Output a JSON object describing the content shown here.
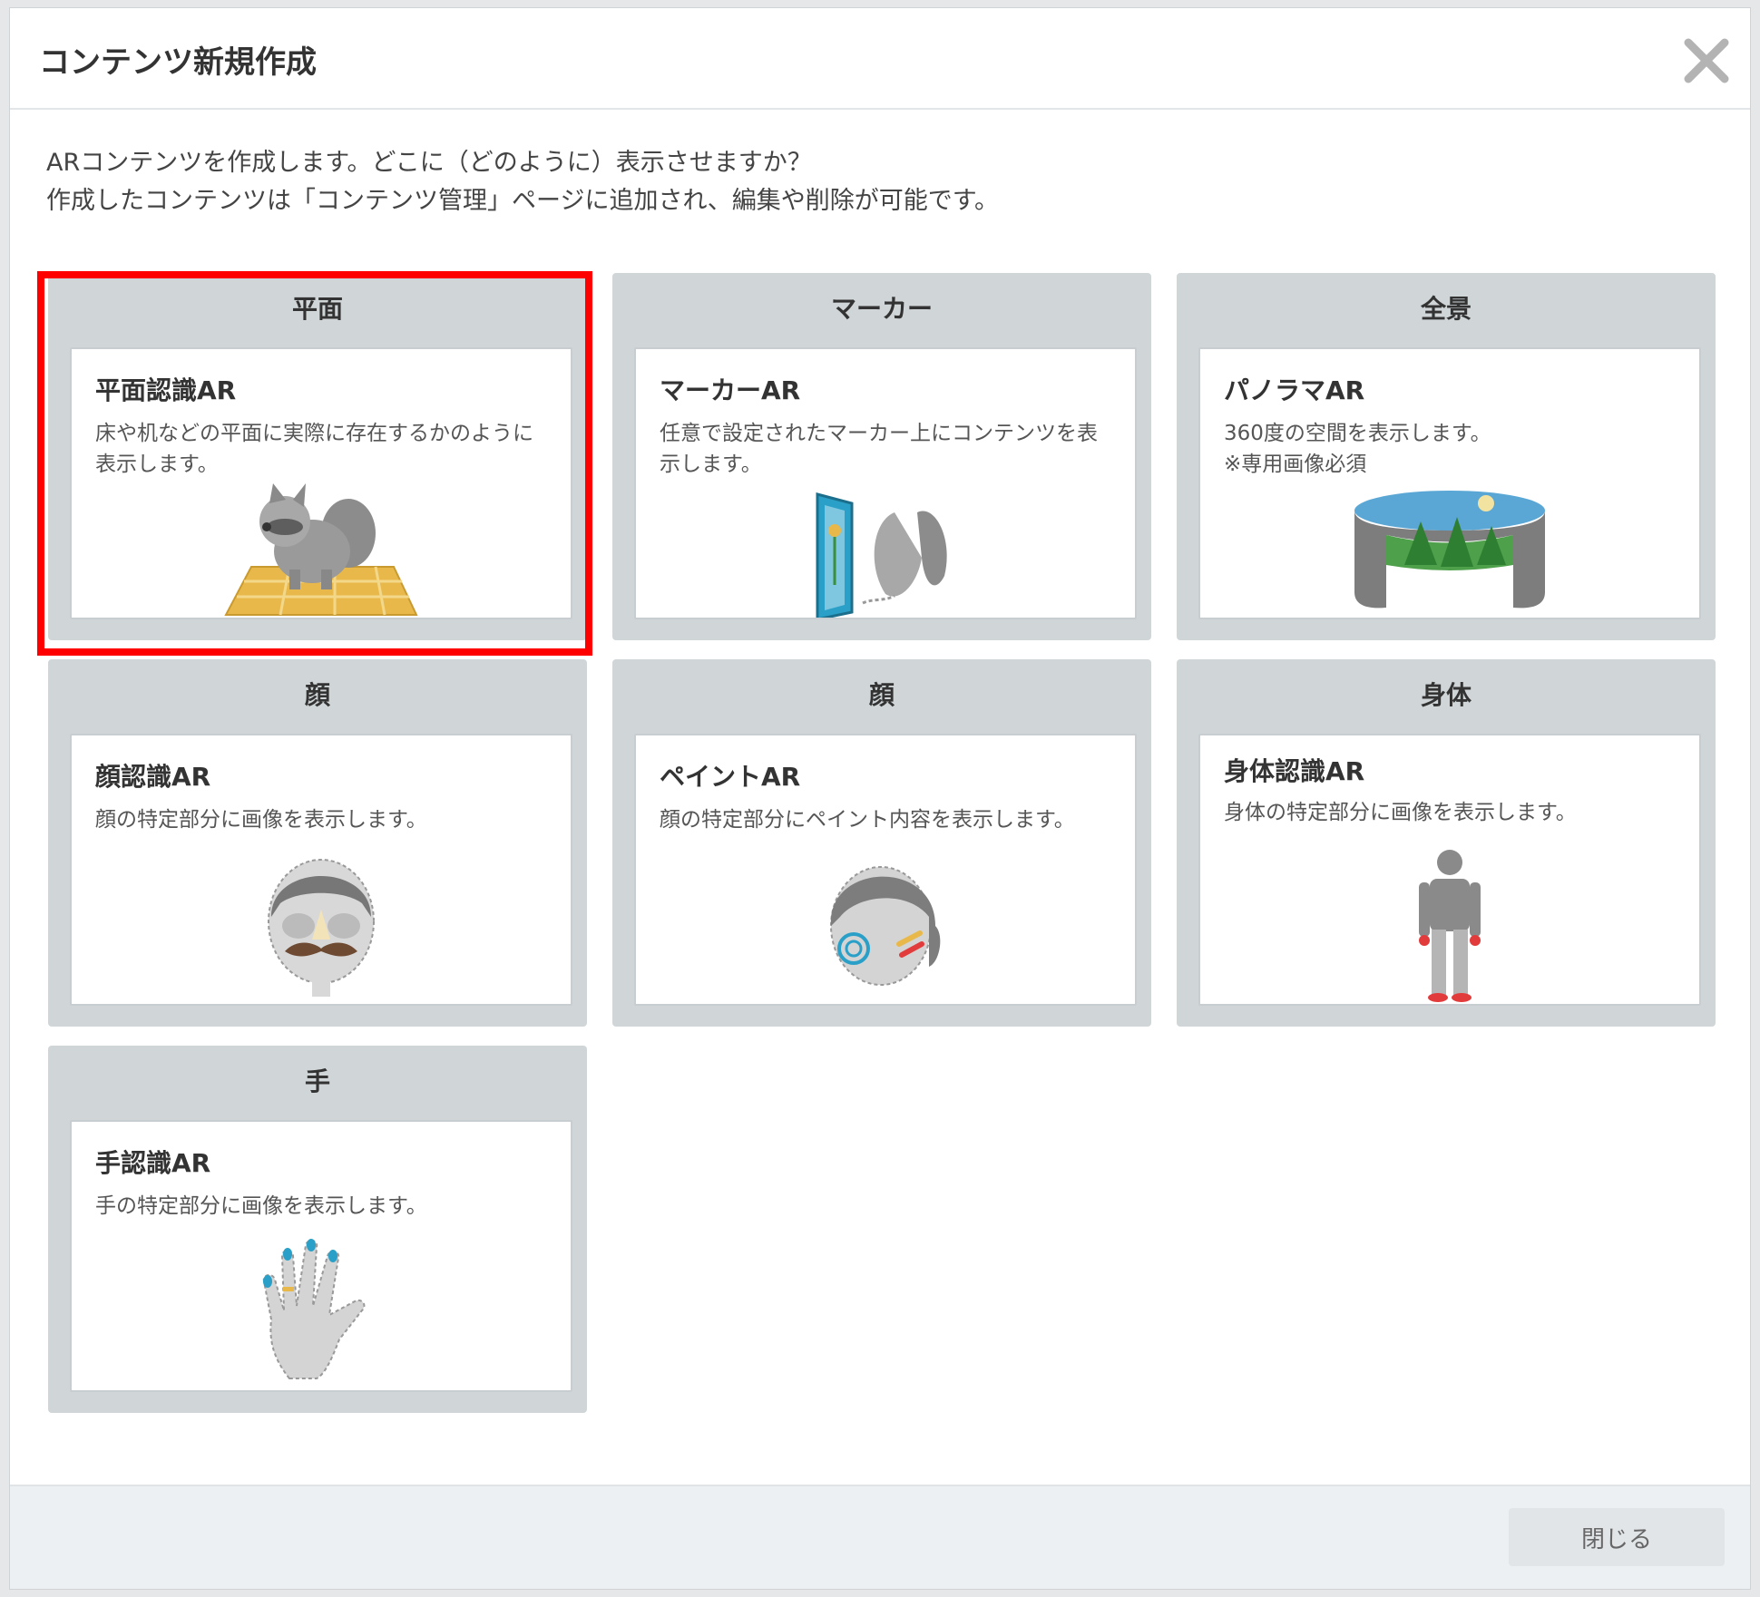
{
  "dialog": {
    "title": "コンテンツ新規作成",
    "close_icon": "close-x-icon"
  },
  "intro": {
    "line1": "ARコンテンツを作成します。どこに（どのように）表示させますか？",
    "line2": "作成したコンテンツは「コンテンツ管理」ページに追加され、編集や削除が可能です。"
  },
  "cards": [
    {
      "category": "平面",
      "name": "平面認識AR",
      "desc": "床や机などの平面に実際に存在するかのように表示します。",
      "icon": "raccoon-on-floor-icon",
      "selected": true
    },
    {
      "category": "マーカー",
      "name": "マーカーAR",
      "desc": "任意で設定されたマーカー上にコンテンツを表示します。",
      "icon": "marker-butterfly-icon",
      "selected": false
    },
    {
      "category": "全景",
      "name": "パノラマAR",
      "desc": "360度の空間を表示します。\n※専用画像必須",
      "icon": "panorama-cylinder-icon",
      "selected": false
    },
    {
      "category": "顔",
      "name": "顔認識AR",
      "desc": "顔の特定部分に画像を表示します。",
      "icon": "face-mustache-icon",
      "selected": false
    },
    {
      "category": "顔",
      "name": "ペイントAR",
      "desc": "顔の特定部分にペイント内容を表示します。",
      "icon": "face-paint-icon",
      "selected": false
    },
    {
      "category": "身体",
      "name": "身体認識AR",
      "desc": "身体の特定部分に画像を表示します。",
      "icon": "body-figure-icon",
      "selected": false
    },
    {
      "category": "手",
      "name": "手認識AR",
      "desc": "手の特定部分に画像を表示します。",
      "icon": "hand-icon",
      "selected": false
    }
  ],
  "footer": {
    "close_label": "閉じる"
  },
  "colors": {
    "card_bg": "#d0d6d8",
    "highlight": "#ff0000",
    "floor": "#e8b84a",
    "sky": "#5aa7d6",
    "tree": "#3a8f3a",
    "accent_blue": "#2aa0c8",
    "accent_red": "#e23b3b"
  }
}
